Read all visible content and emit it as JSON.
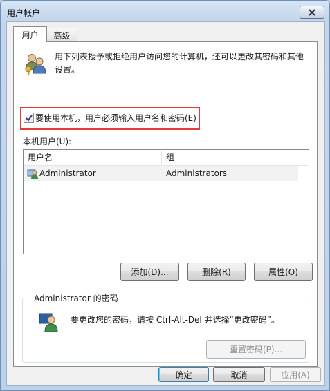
{
  "window": {
    "title": "用户帐户",
    "close_icon": "close-icon"
  },
  "tabs": [
    {
      "label": "用户",
      "active": true
    },
    {
      "label": "高级",
      "active": false
    }
  ],
  "users_tab": {
    "description": "用下列表授予或拒绝用户访问您的计算机，还可以更改其密码和其他设置。",
    "require_login_checkbox": {
      "label": "要使用本机，用户必须输入用户名和密码(E)",
      "checked": true
    },
    "local_users_label": "本机用户(U):",
    "table": {
      "columns": [
        "用户名",
        "组"
      ],
      "rows": [
        {
          "name": "Administrator",
          "group": "Administrators",
          "icon": "user-account-icon"
        }
      ]
    },
    "add_button": "添加(D)...",
    "delete_button": "删除(R)",
    "properties_button": "属性(O)",
    "password_group": {
      "title": "Administrator 的密码",
      "text": "要更改您的密码，请按 Ctrl-Alt-Del 并选择“更改密码”。",
      "reset_button": "重置密码(P)...",
      "reset_enabled": false
    }
  },
  "footer": {
    "ok": "确定",
    "cancel": "取消",
    "apply": "应用(A)",
    "apply_enabled": false
  },
  "colors": {
    "highlight_border": "#e23b3b",
    "default_button_border": "#3c7fb1"
  }
}
